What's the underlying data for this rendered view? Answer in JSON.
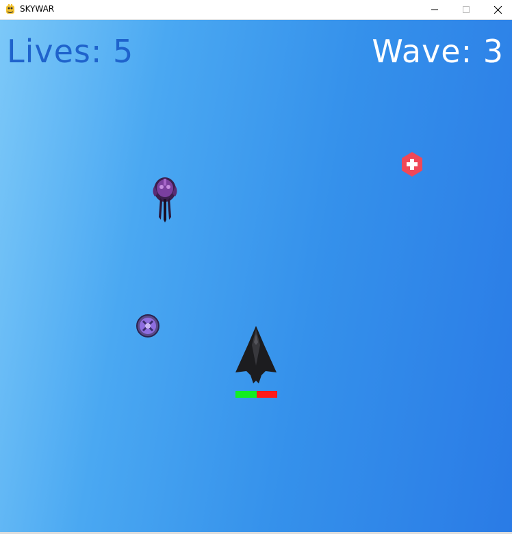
{
  "window": {
    "title": "SKYWAR",
    "icon": "pygame-snake-icon",
    "controls": [
      "minimize-icon",
      "maximize-icon",
      "close-icon"
    ]
  },
  "hud": {
    "lives_text": "Lives: 5",
    "wave_text": "Wave: 3"
  },
  "player": {
    "sprite": "stealth-jet",
    "health_fraction": 0.5,
    "health_color": "#12ee22",
    "damage_color": "#ff1a1a"
  },
  "entities": [
    {
      "type": "enemy-alien-ship",
      "color": "#7a3f9e"
    },
    {
      "type": "power-up-orb",
      "color": "#8e6ee0"
    },
    {
      "type": "health-pack",
      "color": "#f04858"
    }
  ],
  "colors": {
    "sky_light": "#7cc8f8",
    "sky_dark": "#2a7be6",
    "lives_text": "#1f63cc",
    "wave_text": "#ffffff"
  }
}
